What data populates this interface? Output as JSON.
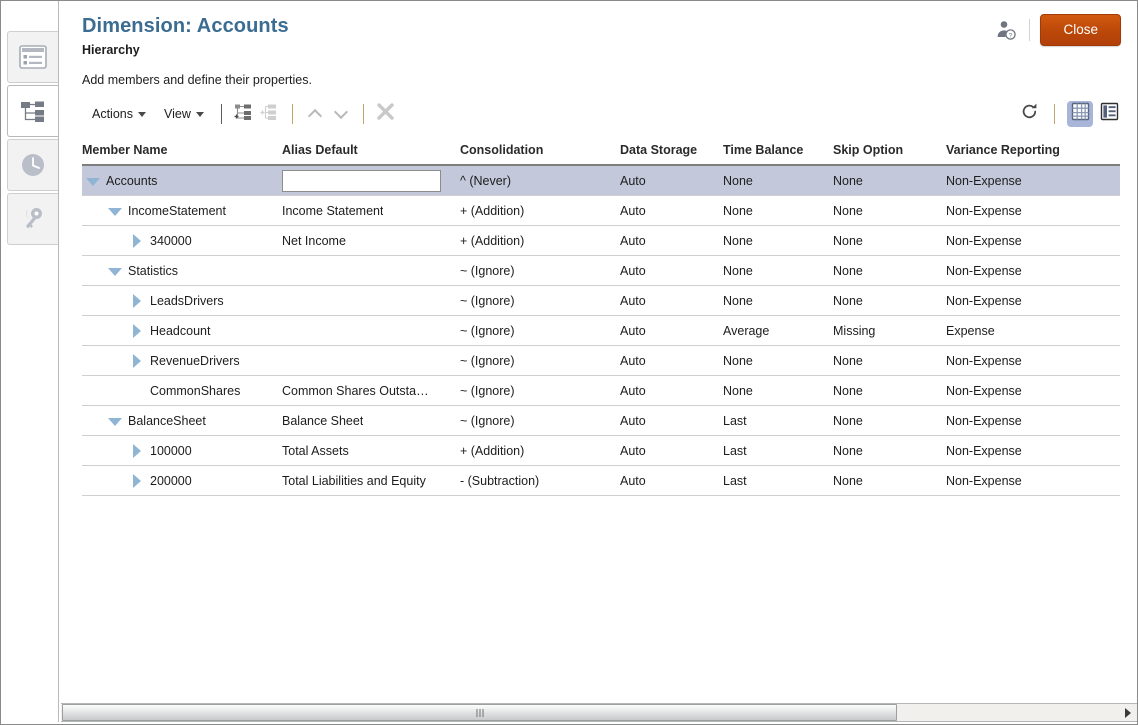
{
  "window": {
    "title": "Dimension: Accounts",
    "subtitle": "Hierarchy",
    "instruction": "Add members and define their properties."
  },
  "header": {
    "user_help_icon": "user-help-icon",
    "close_label": "Close",
    "close_color": "#bb4708"
  },
  "sidebar": {
    "items": [
      {
        "name": "dimension-list-icon",
        "label": "Dimensions",
        "active": false
      },
      {
        "name": "hierarchy-tree-icon",
        "label": "Hierarchy",
        "active": true
      },
      {
        "name": "clock-icon",
        "label": "History",
        "active": false
      },
      {
        "name": "keys-icon",
        "label": "Permissions",
        "active": false
      }
    ]
  },
  "toolbar": {
    "actions_label": "Actions",
    "view_label": "View",
    "add_child_icon": "add-child-member-icon",
    "add_sibling_icon": "add-sibling-member-icon",
    "move_up_icon": "move-up-icon",
    "move_down_icon": "move-down-icon",
    "delete_icon": "delete-member-icon",
    "refresh_icon": "refresh-icon",
    "grid_view_icon": "grid-view-icon",
    "form_view_icon": "form-view-icon",
    "selected_view": "grid"
  },
  "grid": {
    "columns": [
      "Member Name",
      "Alias Default",
      "Consolidation",
      "Data Storage",
      "Time Balance",
      "Skip Option",
      "Variance Reporting"
    ],
    "rows": [
      {
        "member": "Accounts",
        "indent": 0,
        "twisty": "expanded",
        "selected": true,
        "alias": "",
        "alias_editing": true,
        "alias_placeholder": "",
        "consolidation": "^ (Never)",
        "storage": "Auto",
        "time_balance": "None",
        "skip": "None",
        "variance": "Non-Expense"
      },
      {
        "member": "IncomeStatement",
        "indent": 1,
        "twisty": "expanded",
        "selected": false,
        "alias": "Income Statement",
        "alias_editing": false,
        "consolidation": "+ (Addition)",
        "storage": "Auto",
        "time_balance": "None",
        "skip": "None",
        "variance": "Non-Expense"
      },
      {
        "member": "340000",
        "indent": 2,
        "twisty": "collapsed",
        "selected": false,
        "alias": "Net Income",
        "alias_editing": false,
        "consolidation": "+ (Addition)",
        "storage": "Auto",
        "time_balance": "None",
        "skip": "None",
        "variance": "Non-Expense"
      },
      {
        "member": "Statistics",
        "indent": 1,
        "twisty": "expanded",
        "selected": false,
        "alias": "",
        "alias_editing": false,
        "consolidation": "~ (Ignore)",
        "storage": "Auto",
        "time_balance": "None",
        "skip": "None",
        "variance": "Non-Expense"
      },
      {
        "member": "LeadsDrivers",
        "indent": 2,
        "twisty": "collapsed",
        "selected": false,
        "alias": "",
        "alias_editing": false,
        "consolidation": "~ (Ignore)",
        "storage": "Auto",
        "time_balance": "None",
        "skip": "None",
        "variance": "Non-Expense"
      },
      {
        "member": "Headcount",
        "indent": 2,
        "twisty": "collapsed",
        "selected": false,
        "alias": "",
        "alias_editing": false,
        "consolidation": "~ (Ignore)",
        "storage": "Auto",
        "time_balance": "Average",
        "skip": "Missing",
        "variance": "Expense"
      },
      {
        "member": "RevenueDrivers",
        "indent": 2,
        "twisty": "collapsed",
        "selected": false,
        "alias": "",
        "alias_editing": false,
        "consolidation": "~ (Ignore)",
        "storage": "Auto",
        "time_balance": "None",
        "skip": "None",
        "variance": "Non-Expense"
      },
      {
        "member": "CommonShares",
        "indent": 2,
        "twisty": "leaf",
        "selected": false,
        "alias": "Common Shares Outsta…",
        "alias_editing": false,
        "consolidation": "~ (Ignore)",
        "storage": "Auto",
        "time_balance": "None",
        "skip": "None",
        "variance": "Non-Expense"
      },
      {
        "member": "BalanceSheet",
        "indent": 1,
        "twisty": "expanded",
        "selected": false,
        "alias": "Balance Sheet",
        "alias_editing": false,
        "consolidation": "~ (Ignore)",
        "storage": "Auto",
        "time_balance": "Last",
        "skip": "None",
        "variance": "Non-Expense"
      },
      {
        "member": "100000",
        "indent": 2,
        "twisty": "collapsed",
        "selected": false,
        "alias": "Total Assets",
        "alias_editing": false,
        "consolidation": "+ (Addition)",
        "storage": "Auto",
        "time_balance": "Last",
        "skip": "None",
        "variance": "Non-Expense"
      },
      {
        "member": "200000",
        "indent": 2,
        "twisty": "collapsed",
        "selected": false,
        "alias": "Total Liabilities and Equity",
        "alias_editing": false,
        "consolidation": "- (Subtraction)",
        "storage": "Auto",
        "time_balance": "Last",
        "skip": "None",
        "variance": "Non-Expense"
      }
    ]
  },
  "scrollbar": {
    "orientation": "horizontal",
    "thumb_name": "horizontal-scroll-thumb",
    "right_arrow_name": "scroll-right-arrow"
  }
}
